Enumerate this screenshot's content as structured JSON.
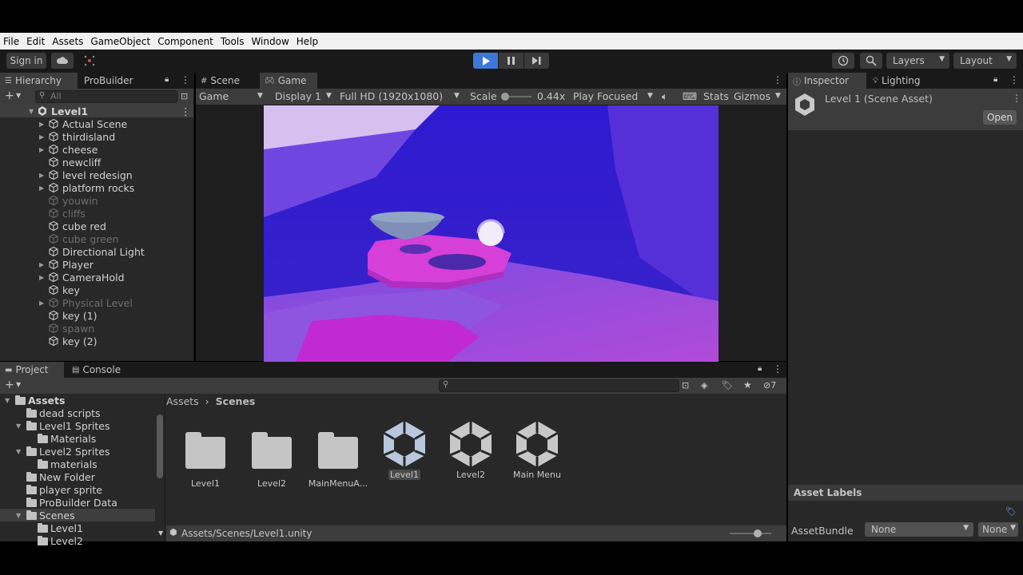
{
  "menu": [
    "File",
    "Edit",
    "Assets",
    "GameObject",
    "Component",
    "Tools",
    "Window",
    "Help"
  ],
  "toolbar": {
    "sign_in": "Sign in",
    "layers": "Layers",
    "layout": "Layout",
    "play_color": "#3c78d8"
  },
  "hierarchy": {
    "tab_hierarchy": "Hierarchy",
    "tab_probuilder": "ProBuilder",
    "search_placeholder": "All",
    "root": "Level1",
    "items": [
      {
        "label": "Actual Scene",
        "expandable": true,
        "dim": false
      },
      {
        "label": "thirdisland",
        "expandable": true,
        "dim": false
      },
      {
        "label": "cheese",
        "expandable": true,
        "dim": false
      },
      {
        "label": "newcliff",
        "expandable": false,
        "dim": false
      },
      {
        "label": "level redesign",
        "expandable": true,
        "dim": false
      },
      {
        "label": "platform rocks",
        "expandable": true,
        "dim": false
      },
      {
        "label": "youwin",
        "expandable": false,
        "dim": true
      },
      {
        "label": "cliffs",
        "expandable": false,
        "dim": true
      },
      {
        "label": "cube red",
        "expandable": false,
        "dim": false
      },
      {
        "label": "cube green",
        "expandable": false,
        "dim": true
      },
      {
        "label": "Directional Light",
        "expandable": false,
        "dim": false
      },
      {
        "label": "Player",
        "expandable": true,
        "dim": false
      },
      {
        "label": "CameraHold",
        "expandable": true,
        "dim": false
      },
      {
        "label": "key",
        "expandable": false,
        "dim": false
      },
      {
        "label": "Physical Level",
        "expandable": true,
        "dim": true
      },
      {
        "label": "key (1)",
        "expandable": false,
        "dim": false
      },
      {
        "label": "spawn",
        "expandable": false,
        "dim": true
      },
      {
        "label": "key (2)",
        "expandable": false,
        "dim": false
      }
    ]
  },
  "game": {
    "tab_scene": "Scene",
    "tab_game": "Game",
    "mode": "Game",
    "display": "Display 1",
    "resolution": "Full HD (1920x1080)",
    "scale_label": "Scale",
    "scale_value": "0.44x",
    "play_focused": "Play Focused",
    "stats": "Stats",
    "gizmos": "Gizmos"
  },
  "inspector": {
    "tab_inspector": "Inspector",
    "tab_lighting": "Lighting",
    "title": "Level 1 (Scene Asset)",
    "open_button": "Open",
    "asset_labels": "Asset Labels",
    "assetbundle_label": "AssetBundle",
    "assetbundle_value": "None",
    "variant_value": "None"
  },
  "project": {
    "tab_project": "Project",
    "tab_console": "Console",
    "hidden_count": "7",
    "tree": [
      {
        "label": "Assets",
        "depth": 0,
        "arrow": true,
        "sel": false
      },
      {
        "label": "dead scripts",
        "depth": 1,
        "arrow": false,
        "sel": false
      },
      {
        "label": "Level1 Sprites",
        "depth": 1,
        "arrow": true,
        "sel": false
      },
      {
        "label": "Materials",
        "depth": 2,
        "arrow": false,
        "sel": false
      },
      {
        "label": "Level2 Sprites",
        "depth": 1,
        "arrow": true,
        "sel": false
      },
      {
        "label": "materials",
        "depth": 2,
        "arrow": false,
        "sel": false
      },
      {
        "label": "New Folder",
        "depth": 1,
        "arrow": false,
        "sel": false
      },
      {
        "label": "player sprite",
        "depth": 1,
        "arrow": false,
        "sel": false
      },
      {
        "label": "ProBuilder Data",
        "depth": 1,
        "arrow": false,
        "sel": false
      },
      {
        "label": "Scenes",
        "depth": 1,
        "arrow": true,
        "sel": true
      },
      {
        "label": "Level1",
        "depth": 2,
        "arrow": false,
        "sel": false
      },
      {
        "label": "Level2",
        "depth": 2,
        "arrow": false,
        "sel": false
      }
    ],
    "breadcrumb_root": "Assets",
    "breadcrumb_current": "Scenes",
    "assets": [
      {
        "label": "Level1",
        "kind": "folder",
        "sel": false
      },
      {
        "label": "Level2",
        "kind": "folder",
        "sel": false
      },
      {
        "label": "MainMenuA...",
        "kind": "folder",
        "sel": false
      },
      {
        "label": "Level1",
        "kind": "scene",
        "sel": true
      },
      {
        "label": "Level2",
        "kind": "scene",
        "sel": false
      },
      {
        "label": "Main Menu",
        "kind": "scene",
        "sel": false
      }
    ],
    "status_path": "Assets/Scenes/Level1.unity"
  }
}
